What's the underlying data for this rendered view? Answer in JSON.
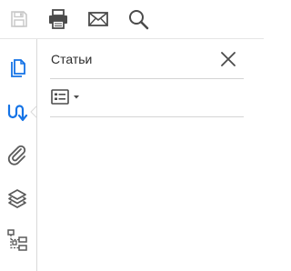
{
  "toolbar": {
    "icons": [
      "save-icon",
      "print-icon",
      "email-icon",
      "search-icon"
    ]
  },
  "rail": {
    "icons": [
      "pages-icon",
      "articles-icon",
      "attachments-icon",
      "layers-icon",
      "structure-icon"
    ],
    "active": "articles-icon"
  },
  "panel": {
    "title": "Статьи",
    "close_icon": "close-icon",
    "options_icon": "list-options-icon"
  },
  "colors": {
    "icon": "#4b4b4b",
    "icon_disabled": "#c8c8c8",
    "accent": "#1473e6",
    "divider": "#d4d4d4"
  }
}
